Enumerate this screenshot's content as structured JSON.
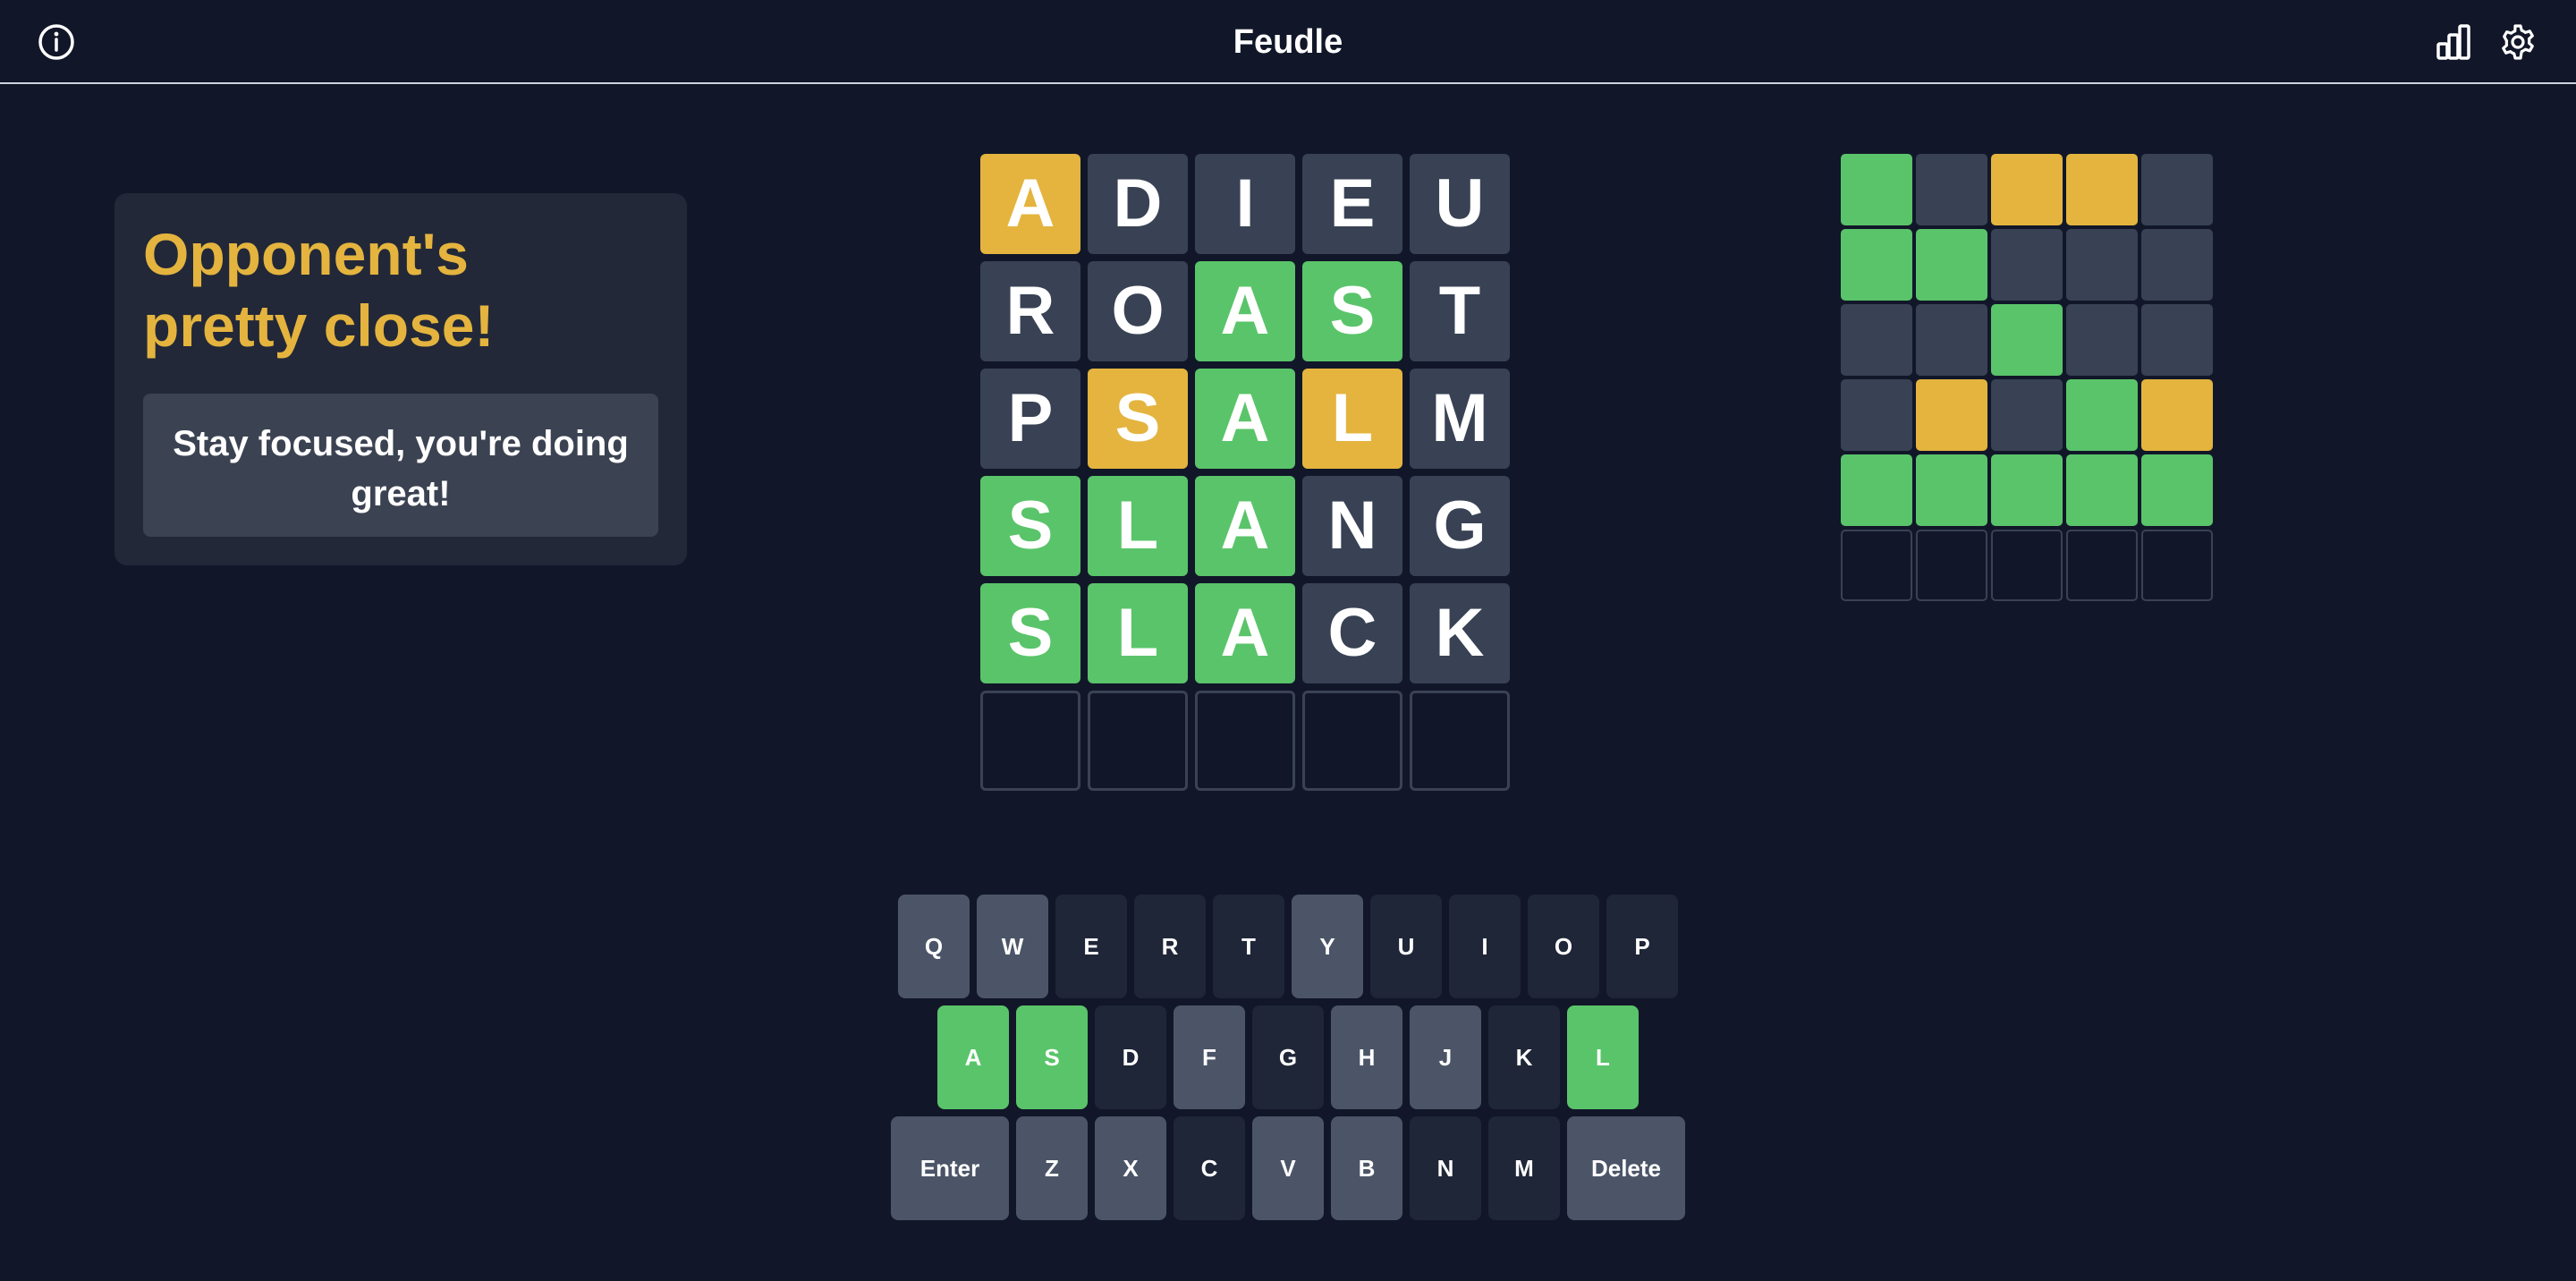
{
  "header": {
    "title": "Feudle",
    "info_icon": "info-circle-icon",
    "stats_icon": "bar-chart-icon",
    "settings_icon": "gear-icon"
  },
  "colors": {
    "background": "#111729",
    "correct": "#5ac46a",
    "present": "#e4b43f",
    "absent": "#384254",
    "key_unused": "#4b5567",
    "key_absent": "#1f2638",
    "status_heading": "#e4b43f"
  },
  "opponent_status": {
    "heading": "Opponent's pretty close!",
    "message": "Stay focused, you're doing great!"
  },
  "player_board": {
    "rows": [
      [
        {
          "letter": "A",
          "state": "present"
        },
        {
          "letter": "D",
          "state": "absent"
        },
        {
          "letter": "I",
          "state": "absent"
        },
        {
          "letter": "E",
          "state": "absent"
        },
        {
          "letter": "U",
          "state": "absent"
        }
      ],
      [
        {
          "letter": "R",
          "state": "absent"
        },
        {
          "letter": "O",
          "state": "absent"
        },
        {
          "letter": "A",
          "state": "correct"
        },
        {
          "letter": "S",
          "state": "correct"
        },
        {
          "letter": "T",
          "state": "absent"
        }
      ],
      [
        {
          "letter": "P",
          "state": "absent"
        },
        {
          "letter": "S",
          "state": "present"
        },
        {
          "letter": "A",
          "state": "correct"
        },
        {
          "letter": "L",
          "state": "present"
        },
        {
          "letter": "M",
          "state": "absent"
        }
      ],
      [
        {
          "letter": "S",
          "state": "correct"
        },
        {
          "letter": "L",
          "state": "correct"
        },
        {
          "letter": "A",
          "state": "correct"
        },
        {
          "letter": "N",
          "state": "absent"
        },
        {
          "letter": "G",
          "state": "absent"
        }
      ],
      [
        {
          "letter": "S",
          "state": "correct"
        },
        {
          "letter": "L",
          "state": "correct"
        },
        {
          "letter": "A",
          "state": "correct"
        },
        {
          "letter": "C",
          "state": "absent"
        },
        {
          "letter": "K",
          "state": "absent"
        }
      ],
      [
        {
          "letter": "",
          "state": "empty"
        },
        {
          "letter": "",
          "state": "empty"
        },
        {
          "letter": "",
          "state": "empty"
        },
        {
          "letter": "",
          "state": "empty"
        },
        {
          "letter": "",
          "state": "empty"
        }
      ]
    ]
  },
  "opponent_board": {
    "rows": [
      [
        "correct",
        "absent",
        "present",
        "present",
        "absent"
      ],
      [
        "correct",
        "correct",
        "absent",
        "absent",
        "absent"
      ],
      [
        "absent",
        "absent",
        "correct",
        "absent",
        "absent"
      ],
      [
        "absent",
        "present",
        "absent",
        "correct",
        "present"
      ],
      [
        "correct",
        "correct",
        "correct",
        "correct",
        "correct"
      ],
      [
        "empty",
        "empty",
        "empty",
        "empty",
        "empty"
      ]
    ]
  },
  "keyboard": {
    "rows": [
      [
        {
          "label": "Q",
          "state": "unused"
        },
        {
          "label": "W",
          "state": "unused"
        },
        {
          "label": "E",
          "state": "absent"
        },
        {
          "label": "R",
          "state": "absent"
        },
        {
          "label": "T",
          "state": "absent"
        },
        {
          "label": "Y",
          "state": "unused"
        },
        {
          "label": "U",
          "state": "absent"
        },
        {
          "label": "I",
          "state": "absent"
        },
        {
          "label": "O",
          "state": "absent"
        },
        {
          "label": "P",
          "state": "absent"
        }
      ],
      [
        {
          "label": "A",
          "state": "correct"
        },
        {
          "label": "S",
          "state": "correct"
        },
        {
          "label": "D",
          "state": "absent"
        },
        {
          "label": "F",
          "state": "unused"
        },
        {
          "label": "G",
          "state": "absent"
        },
        {
          "label": "H",
          "state": "unused"
        },
        {
          "label": "J",
          "state": "unused"
        },
        {
          "label": "K",
          "state": "absent"
        },
        {
          "label": "L",
          "state": "correct"
        }
      ],
      [
        {
          "label": "Enter",
          "state": "unused",
          "wide": true
        },
        {
          "label": "Z",
          "state": "unused"
        },
        {
          "label": "X",
          "state": "unused"
        },
        {
          "label": "C",
          "state": "absent"
        },
        {
          "label": "V",
          "state": "unused"
        },
        {
          "label": "B",
          "state": "unused"
        },
        {
          "label": "N",
          "state": "absent"
        },
        {
          "label": "M",
          "state": "absent"
        },
        {
          "label": "Delete",
          "state": "unused",
          "wide": true
        }
      ]
    ]
  }
}
